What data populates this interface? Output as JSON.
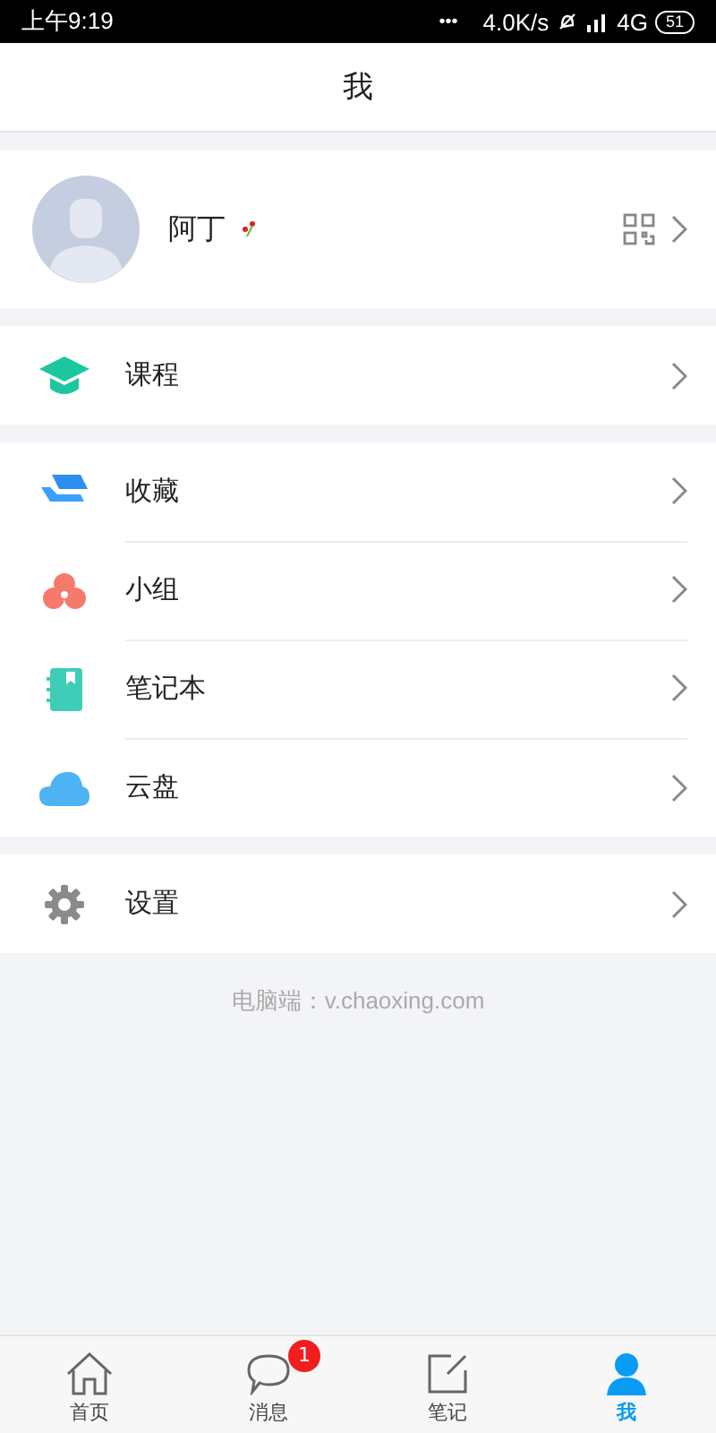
{
  "status_bar": {
    "time": "上午9:19",
    "dots": "•••",
    "speed": "4.0K/s",
    "network": "4G",
    "battery": "51"
  },
  "header": {
    "title": "我"
  },
  "profile": {
    "name": "阿丁"
  },
  "menu_groups": [
    [
      {
        "kind": "course",
        "label": "课程"
      }
    ],
    [
      {
        "kind": "collect",
        "label": "收藏"
      },
      {
        "kind": "group",
        "label": "小组"
      },
      {
        "kind": "notebook",
        "label": "笔记本"
      },
      {
        "kind": "cloud",
        "label": "云盘"
      }
    ],
    [
      {
        "kind": "settings",
        "label": "设置"
      }
    ]
  ],
  "footer_note": "电脑端：v.chaoxing.com",
  "tabs": [
    {
      "kind": "home",
      "label": "首页",
      "selected": false
    },
    {
      "kind": "message",
      "label": "消息",
      "selected": false,
      "badge": "1"
    },
    {
      "kind": "note",
      "label": "笔记",
      "selected": false
    },
    {
      "kind": "me",
      "label": "我",
      "selected": true
    }
  ]
}
